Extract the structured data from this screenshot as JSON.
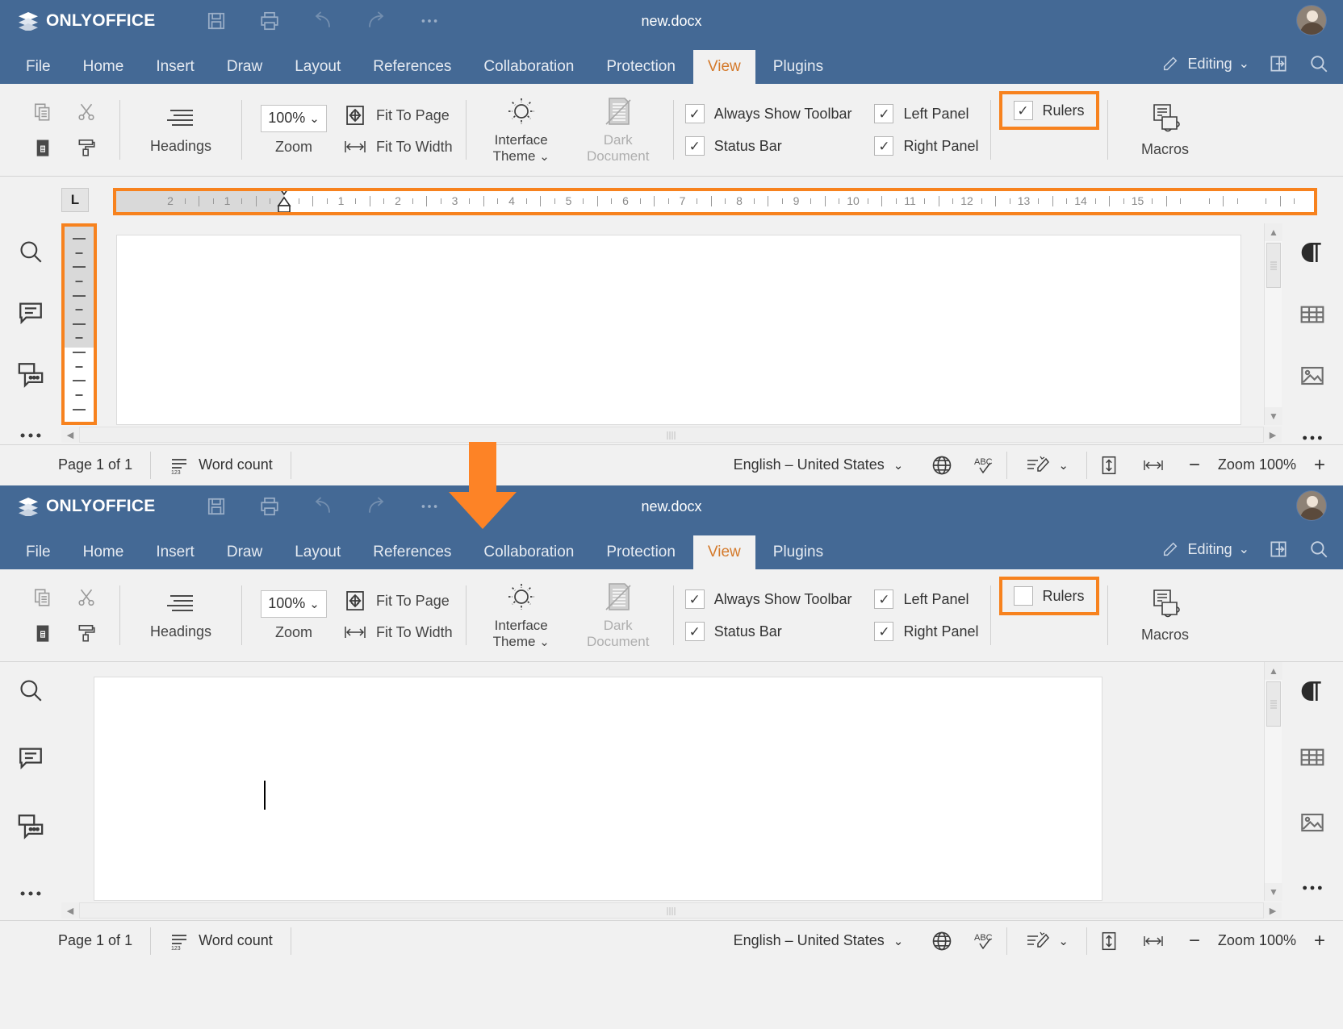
{
  "app": {
    "brand": "ONLYOFFICE",
    "document_title": "new.docx",
    "titlebar_icons": [
      "save-icon",
      "print-icon",
      "undo-icon",
      "redo-icon",
      "more-icon"
    ],
    "avatar": "user-avatar"
  },
  "tabs": [
    {
      "label": "File",
      "active": false
    },
    {
      "label": "Home",
      "active": false
    },
    {
      "label": "Insert",
      "active": false
    },
    {
      "label": "Draw",
      "active": false
    },
    {
      "label": "Layout",
      "active": false
    },
    {
      "label": "References",
      "active": false
    },
    {
      "label": "Collaboration",
      "active": false
    },
    {
      "label": "Protection",
      "active": false
    },
    {
      "label": "View",
      "active": true
    },
    {
      "label": "Plugins",
      "active": false
    }
  ],
  "tabs_right": {
    "editing_label": "Editing",
    "chevron": "⌄",
    "open_location_icon": "open-file-location-icon",
    "search_icon": "search-icon"
  },
  "ribbon": {
    "clipboard": {
      "copy_icon": "copy-icon",
      "cut_icon": "cut-icon",
      "paste_icon": "paste-icon",
      "format_painter_icon": "format-painter-icon"
    },
    "headings": {
      "label": "Headings",
      "icon": "headings-icon"
    },
    "zoom": {
      "value": "100%",
      "chevron": "⌄",
      "label": "Zoom",
      "fit_to_page": "Fit To Page",
      "fit_to_width": "Fit To Width",
      "fit_page_icon": "fit-to-page-icon",
      "fit_width_icon": "fit-to-width-icon"
    },
    "interface_theme": {
      "line1": "Interface",
      "line2": "Theme",
      "chevron": "⌄",
      "icon": "sun-icon"
    },
    "dark_document": {
      "line1": "Dark",
      "line2": "Document",
      "icon": "dark-document-icon",
      "disabled": true
    },
    "checkboxes_top": [
      {
        "label": "Always Show Toolbar",
        "checked": true
      },
      {
        "label": "Status Bar",
        "checked": true
      },
      {
        "label": "Left Panel",
        "checked": true
      },
      {
        "label": "Right Panel",
        "checked": true
      }
    ],
    "macros": {
      "label": "Macros",
      "icon": "macros-icon"
    }
  },
  "window_top": {
    "rulers": {
      "label": "Rulers",
      "checked": true,
      "highlighted": true
    },
    "ruler_visible": true,
    "tab_stop_marker": "L",
    "h_ruler_numbers": [
      2,
      1,
      1,
      2,
      3,
      4,
      5,
      6,
      7,
      8,
      9,
      10,
      11,
      12,
      13,
      14,
      15
    ],
    "vertical_ruler_highlighted": true
  },
  "window_bottom": {
    "rulers": {
      "label": "Rulers",
      "checked": false,
      "highlighted": true
    },
    "ruler_visible": false,
    "vertical_ruler_highlighted": false
  },
  "left_panel_icons": [
    "search-icon",
    "comments-icon",
    "chat-icon",
    "more-icon"
  ],
  "right_panel_icons": [
    "paragraph-settings-icon",
    "table-settings-icon",
    "image-settings-icon",
    "more-icon"
  ],
  "status_bar": {
    "page_label": "Page 1 of 1",
    "word_count_label": "Word count",
    "word_count_icon": "word-count-icon",
    "language": "English – United States",
    "language_chevron": "⌄",
    "globe_icon": "set-language-icon",
    "spellcheck_icon": "spell-checking-icon",
    "track_changes_icon": "track-changes-icon",
    "track_changes_chevron": "⌄",
    "fit_page_icon": "fit-to-page-icon",
    "fit_width_icon": "fit-to-width-icon",
    "zoom_out": "−",
    "zoom_label": "Zoom 100%",
    "zoom_in": "+"
  },
  "annotation": {
    "arrow": "down-arrow",
    "accent_color": "#f7821e"
  }
}
